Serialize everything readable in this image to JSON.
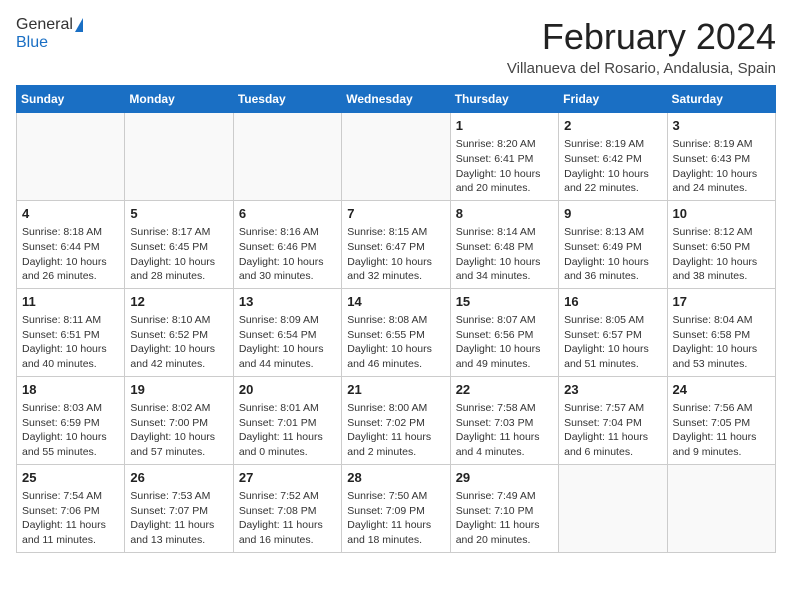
{
  "logo": {
    "line1": "General",
    "line2": "Blue"
  },
  "title": "February 2024",
  "subtitle": "Villanueva del Rosario, Andalusia, Spain",
  "weekdays": [
    "Sunday",
    "Monday",
    "Tuesday",
    "Wednesday",
    "Thursday",
    "Friday",
    "Saturday"
  ],
  "weeks": [
    [
      {
        "day": "",
        "info": ""
      },
      {
        "day": "",
        "info": ""
      },
      {
        "day": "",
        "info": ""
      },
      {
        "day": "",
        "info": ""
      },
      {
        "day": "1",
        "info": "Sunrise: 8:20 AM\nSunset: 6:41 PM\nDaylight: 10 hours\nand 20 minutes."
      },
      {
        "day": "2",
        "info": "Sunrise: 8:19 AM\nSunset: 6:42 PM\nDaylight: 10 hours\nand 22 minutes."
      },
      {
        "day": "3",
        "info": "Sunrise: 8:19 AM\nSunset: 6:43 PM\nDaylight: 10 hours\nand 24 minutes."
      }
    ],
    [
      {
        "day": "4",
        "info": "Sunrise: 8:18 AM\nSunset: 6:44 PM\nDaylight: 10 hours\nand 26 minutes."
      },
      {
        "day": "5",
        "info": "Sunrise: 8:17 AM\nSunset: 6:45 PM\nDaylight: 10 hours\nand 28 minutes."
      },
      {
        "day": "6",
        "info": "Sunrise: 8:16 AM\nSunset: 6:46 PM\nDaylight: 10 hours\nand 30 minutes."
      },
      {
        "day": "7",
        "info": "Sunrise: 8:15 AM\nSunset: 6:47 PM\nDaylight: 10 hours\nand 32 minutes."
      },
      {
        "day": "8",
        "info": "Sunrise: 8:14 AM\nSunset: 6:48 PM\nDaylight: 10 hours\nand 34 minutes."
      },
      {
        "day": "9",
        "info": "Sunrise: 8:13 AM\nSunset: 6:49 PM\nDaylight: 10 hours\nand 36 minutes."
      },
      {
        "day": "10",
        "info": "Sunrise: 8:12 AM\nSunset: 6:50 PM\nDaylight: 10 hours\nand 38 minutes."
      }
    ],
    [
      {
        "day": "11",
        "info": "Sunrise: 8:11 AM\nSunset: 6:51 PM\nDaylight: 10 hours\nand 40 minutes."
      },
      {
        "day": "12",
        "info": "Sunrise: 8:10 AM\nSunset: 6:52 PM\nDaylight: 10 hours\nand 42 minutes."
      },
      {
        "day": "13",
        "info": "Sunrise: 8:09 AM\nSunset: 6:54 PM\nDaylight: 10 hours\nand 44 minutes."
      },
      {
        "day": "14",
        "info": "Sunrise: 8:08 AM\nSunset: 6:55 PM\nDaylight: 10 hours\nand 46 minutes."
      },
      {
        "day": "15",
        "info": "Sunrise: 8:07 AM\nSunset: 6:56 PM\nDaylight: 10 hours\nand 49 minutes."
      },
      {
        "day": "16",
        "info": "Sunrise: 8:05 AM\nSunset: 6:57 PM\nDaylight: 10 hours\nand 51 minutes."
      },
      {
        "day": "17",
        "info": "Sunrise: 8:04 AM\nSunset: 6:58 PM\nDaylight: 10 hours\nand 53 minutes."
      }
    ],
    [
      {
        "day": "18",
        "info": "Sunrise: 8:03 AM\nSunset: 6:59 PM\nDaylight: 10 hours\nand 55 minutes."
      },
      {
        "day": "19",
        "info": "Sunrise: 8:02 AM\nSunset: 7:00 PM\nDaylight: 10 hours\nand 57 minutes."
      },
      {
        "day": "20",
        "info": "Sunrise: 8:01 AM\nSunset: 7:01 PM\nDaylight: 11 hours\nand 0 minutes."
      },
      {
        "day": "21",
        "info": "Sunrise: 8:00 AM\nSunset: 7:02 PM\nDaylight: 11 hours\nand 2 minutes."
      },
      {
        "day": "22",
        "info": "Sunrise: 7:58 AM\nSunset: 7:03 PM\nDaylight: 11 hours\nand 4 minutes."
      },
      {
        "day": "23",
        "info": "Sunrise: 7:57 AM\nSunset: 7:04 PM\nDaylight: 11 hours\nand 6 minutes."
      },
      {
        "day": "24",
        "info": "Sunrise: 7:56 AM\nSunset: 7:05 PM\nDaylight: 11 hours\nand 9 minutes."
      }
    ],
    [
      {
        "day": "25",
        "info": "Sunrise: 7:54 AM\nSunset: 7:06 PM\nDaylight: 11 hours\nand 11 minutes."
      },
      {
        "day": "26",
        "info": "Sunrise: 7:53 AM\nSunset: 7:07 PM\nDaylight: 11 hours\nand 13 minutes."
      },
      {
        "day": "27",
        "info": "Sunrise: 7:52 AM\nSunset: 7:08 PM\nDaylight: 11 hours\nand 16 minutes."
      },
      {
        "day": "28",
        "info": "Sunrise: 7:50 AM\nSunset: 7:09 PM\nDaylight: 11 hours\nand 18 minutes."
      },
      {
        "day": "29",
        "info": "Sunrise: 7:49 AM\nSunset: 7:10 PM\nDaylight: 11 hours\nand 20 minutes."
      },
      {
        "day": "",
        "info": ""
      },
      {
        "day": "",
        "info": ""
      }
    ]
  ]
}
